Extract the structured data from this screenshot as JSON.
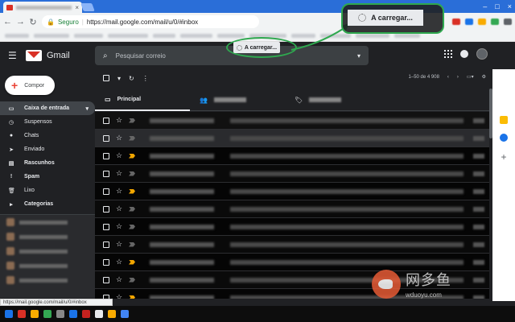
{
  "browser": {
    "tab_close": "×",
    "omnibox": {
      "secure_label": "Seguro",
      "url": "https://mail.google.com/mail/u/0/#inbox"
    },
    "window_controls": [
      "–",
      "□",
      "×"
    ]
  },
  "header": {
    "app_name": "Gmail",
    "search_placeholder": "Pesquisar correio"
  },
  "loading": {
    "label": "A carregar...",
    "callout_label": "A carregar..."
  },
  "sidebar": {
    "compose_label": "Compor",
    "items": [
      {
        "label": "Caixa de entrada",
        "icon": "inbox-icon",
        "active": true
      },
      {
        "label": "Suspensos",
        "icon": "clock-icon"
      },
      {
        "label": "Chats",
        "icon": "chat-icon"
      },
      {
        "label": "Enviado",
        "icon": "send-icon"
      },
      {
        "label": "Rascunhos",
        "icon": "draft-icon"
      },
      {
        "label": "Spam",
        "icon": "spam-icon"
      },
      {
        "label": "Lixo",
        "icon": "trash-icon"
      },
      {
        "label": "Categorias",
        "icon": "tag-icon"
      }
    ]
  },
  "mail_toolbar": {
    "counter": "1–50 de 4 908"
  },
  "categories": {
    "primary": "Principal"
  },
  "statusbar": {
    "text": "https://mail.google.com/mail/u/0/#inbox"
  },
  "watermark": {
    "cn": "网多鱼",
    "url": "wduoyu.com"
  },
  "colors": {
    "chrome_blue": "#2a6ed8",
    "gmail_red": "#d93025",
    "callout_green": "#2fa84f",
    "dark_bg": "#202124",
    "important_marker": "#f2a600"
  }
}
